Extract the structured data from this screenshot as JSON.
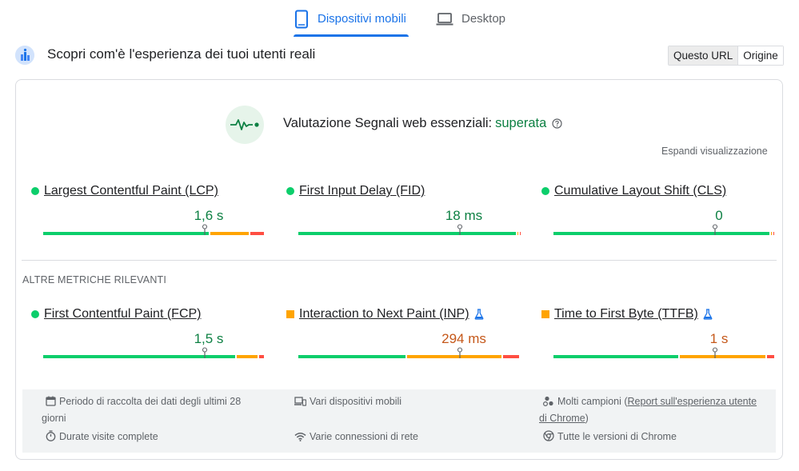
{
  "tabs": [
    {
      "label": "Dispositivi mobili",
      "icon": "smartphone-icon",
      "active": true
    },
    {
      "label": "Desktop",
      "icon": "laptop-icon",
      "active": false
    }
  ],
  "header": {
    "title": "Scopri com'è l'esperienza dei tuoi utenti reali",
    "icon": "crux-users-icon",
    "toggle": [
      "Questo URL",
      "Origine"
    ],
    "toggle_active": "Questo URL"
  },
  "assessment": {
    "label": "Valutazione Segnali web essenziali:",
    "status": "superata",
    "expand_label": "Espandi visualizzazione"
  },
  "core_metrics": [
    {
      "label": "Largest Contentful Paint (LCP)",
      "value": "1,6 s",
      "rating": "good",
      "distribution": {
        "good": 0.75,
        "average": 0.18,
        "poor": 0.07
      },
      "marker": 0.75
    },
    {
      "label": "First Input Delay (FID)",
      "value": "18 ms",
      "rating": "good",
      "distribution": {
        "good": 0.985,
        "average": 0.01,
        "poor": 0.005
      },
      "marker": 0.75
    },
    {
      "label": "Cumulative Layout Shift (CLS)",
      "value": "0",
      "rating": "good",
      "distribution": {
        "good": 0.98,
        "average": 0.01,
        "poor": 0.01
      },
      "marker": 0.75
    }
  ],
  "other_heading": "ALTRE METRICHE RILEVANTI",
  "other_metrics": [
    {
      "label": "First Contentful Paint (FCP)",
      "value": "1,5 s",
      "rating": "good",
      "experimental": false,
      "distribution": {
        "good": 0.87,
        "average": 0.1,
        "poor": 0.03
      },
      "marker": 0.75
    },
    {
      "label": "Interaction to Next Paint (INP)",
      "value": "294 ms",
      "rating": "average",
      "experimental": true,
      "distribution": {
        "good": 0.49,
        "average": 0.43,
        "poor": 0.08
      },
      "marker": 0.75
    },
    {
      "label": "Time to First Byte (TTFB)",
      "value": "1 s",
      "rating": "average",
      "experimental": true,
      "distribution": {
        "good": 0.57,
        "average": 0.39,
        "poor": 0.04
      },
      "marker": 0.75
    }
  ],
  "info": {
    "collection_period": "Periodo di raccolta dei dati degli ultimi 28 giorni",
    "visit_duration": "Durate visite complete",
    "devices": "Vari dispositivi mobili",
    "connections": "Varie connessioni di rete",
    "samples_prefix": "Molti campioni (",
    "samples_link": "Report sull'esperienza utente di Chrome",
    "samples_suffix": ")",
    "chrome_versions": "Tutte le versioni di Chrome"
  },
  "colors": {
    "accent": "#1a73e8",
    "good": "#0cce6b",
    "average": "#ffa400",
    "poor": "#ff4e42",
    "good_text": "#0d8043",
    "average_text": "#c5581a"
  }
}
